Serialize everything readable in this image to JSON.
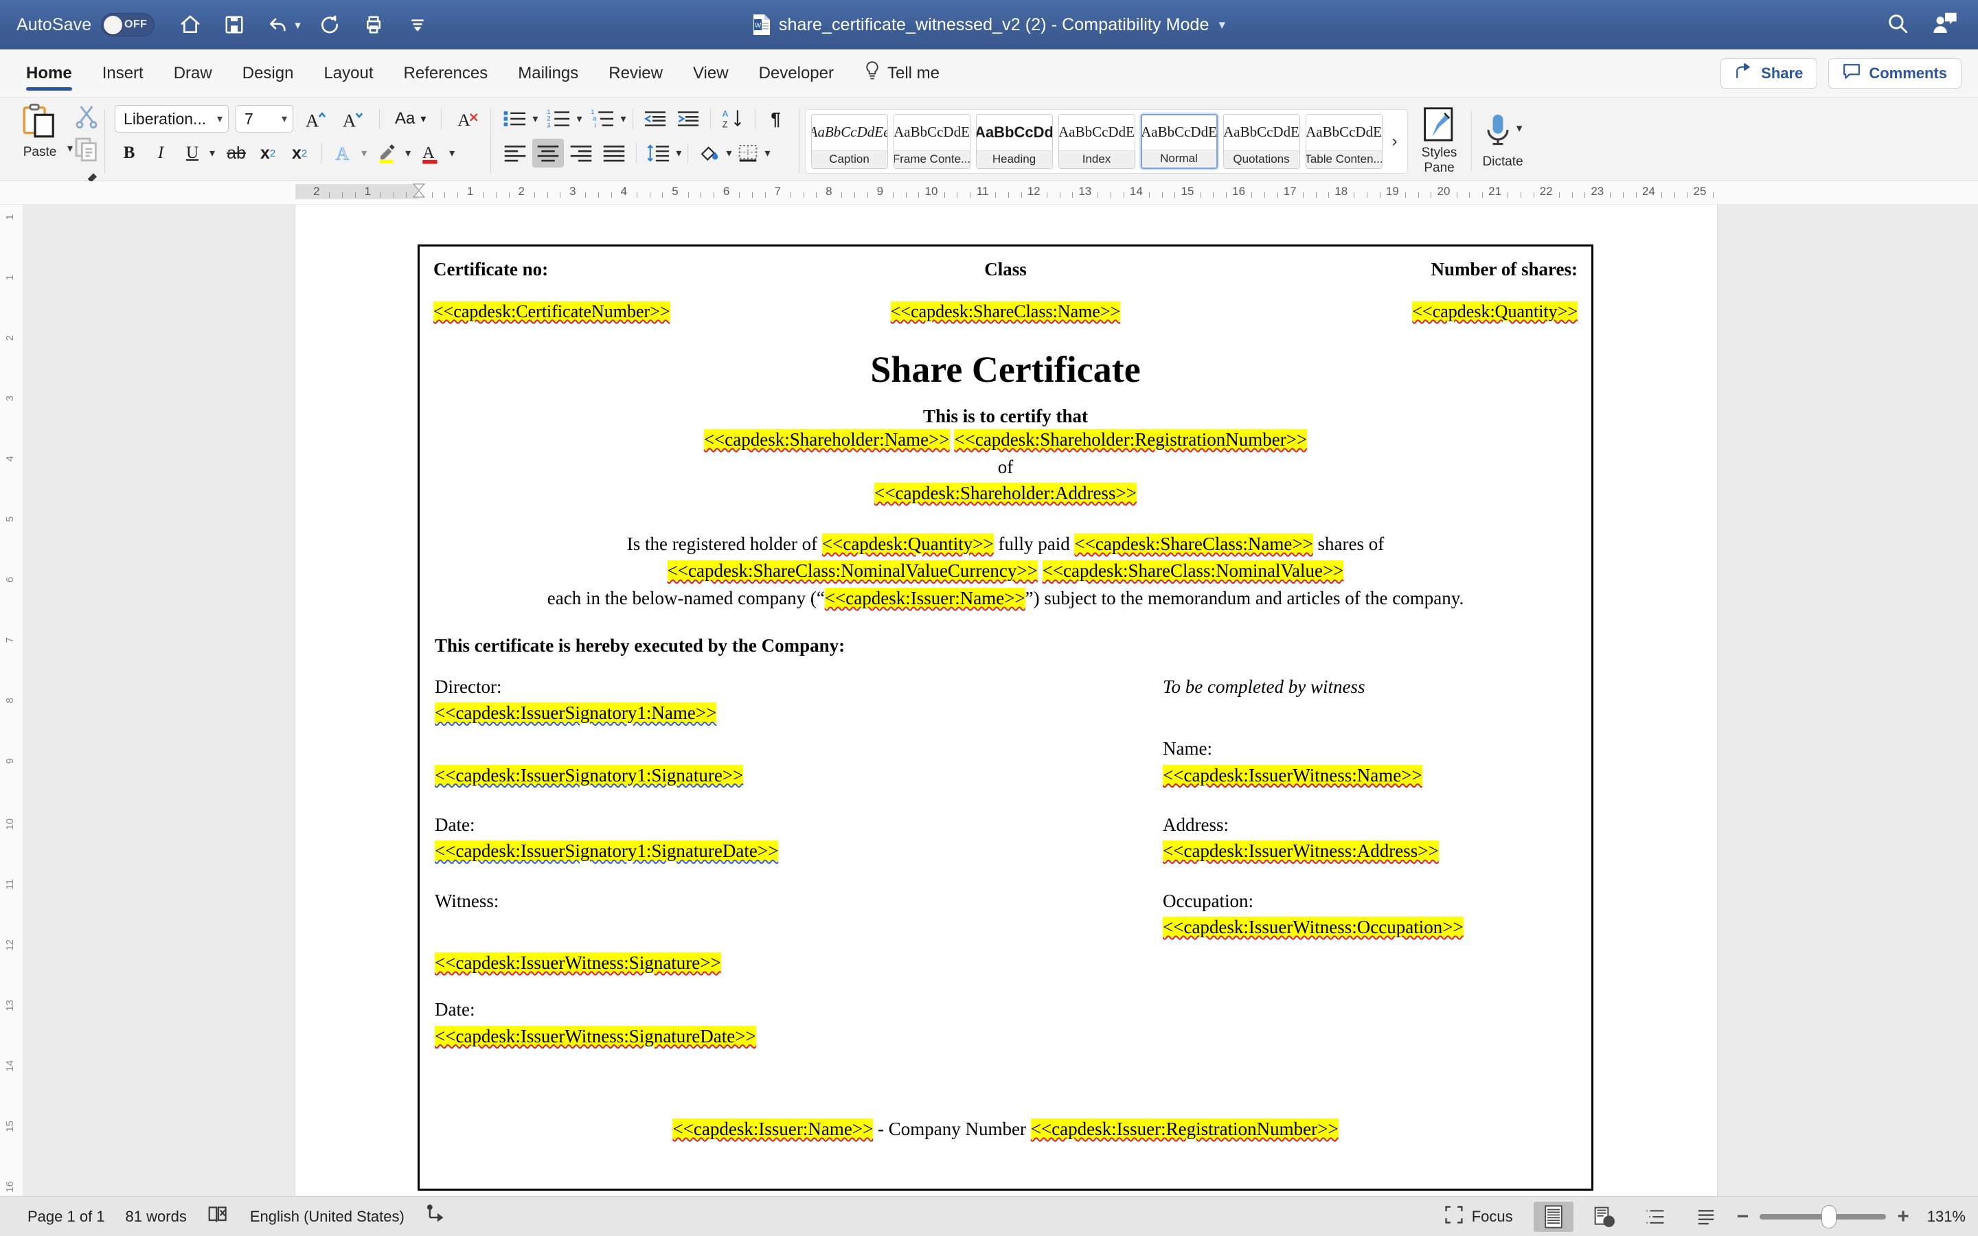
{
  "titlebar": {
    "autosave_label": "AutoSave",
    "autosave_state": "OFF",
    "doc_title": "share_certificate_witnessed_v2 (2)  -  Compatibility Mode",
    "quick_access": [
      "home-icon",
      "save-icon",
      "undo-icon",
      "redo-icon",
      "print-icon",
      "customize-qat-icon"
    ],
    "right_icons": [
      "search-icon",
      "account-comment-icon"
    ]
  },
  "ribbon_tabs": {
    "items": [
      {
        "label": "Home",
        "active": true
      },
      {
        "label": "Insert",
        "active": false
      },
      {
        "label": "Draw",
        "active": false
      },
      {
        "label": "Design",
        "active": false
      },
      {
        "label": "Layout",
        "active": false
      },
      {
        "label": "References",
        "active": false
      },
      {
        "label": "Mailings",
        "active": false
      },
      {
        "label": "Review",
        "active": false
      },
      {
        "label": "View",
        "active": false
      },
      {
        "label": "Developer",
        "active": false
      }
    ],
    "tell_me": "Tell me",
    "share": "Share",
    "comments": "Comments"
  },
  "ribbon": {
    "paste_label": "Paste",
    "font_name": "Liberation...",
    "font_size": "7",
    "grow_font": "A",
    "shrink_font": "A",
    "change_case": "Aa",
    "clear_formatting": "A",
    "bold": "B",
    "italic": "I",
    "underline": "U",
    "strikethrough": "ab",
    "subscript": "x",
    "subscript_sub": "2",
    "superscript": "x",
    "superscript_sup": "2",
    "text_effects": "A",
    "highlight": "A",
    "font_color": "A",
    "styles": [
      {
        "preview": "AaBbCcDdEe",
        "name": "Caption",
        "style": "italic",
        "selected": false
      },
      {
        "preview": "AaBbCcDdE",
        "name": "Frame Conte...",
        "style": "serif",
        "selected": false
      },
      {
        "preview": "AaBbCcDd",
        "name": "Heading",
        "style": "bold",
        "selected": false
      },
      {
        "preview": "AaBbCcDdE",
        "name": "Index",
        "style": "serif",
        "selected": false
      },
      {
        "preview": "AaBbCcDdE",
        "name": "Normal",
        "style": "serif",
        "selected": true
      },
      {
        "preview": "AaBbCcDdE",
        "name": "Quotations",
        "style": "serif",
        "selected": false
      },
      {
        "preview": "AaBbCcDdE",
        "name": "Table Conten...",
        "style": "serif",
        "selected": false
      }
    ],
    "styles_pane_line1": "Styles",
    "styles_pane_line2": "Pane",
    "dictate_label": "Dictate"
  },
  "ruler": {
    "numbers": [
      "2",
      "1",
      "1",
      "2",
      "3",
      "4",
      "5",
      "6",
      "7",
      "8",
      "9",
      "10",
      "11",
      "12",
      "13",
      "14",
      "15",
      "16",
      "17",
      "18",
      "19",
      "20",
      "21",
      "22",
      "23",
      "24",
      "25"
    ],
    "vertical_numbers": [
      "1",
      "1",
      "2",
      "3",
      "4",
      "5",
      "6",
      "7",
      "8",
      "9",
      "10",
      "11",
      "12",
      "13",
      "14",
      "15",
      "16"
    ]
  },
  "document": {
    "header": {
      "certificate_no_label": "Certificate no:",
      "class_label": "Class",
      "number_of_shares_label": "Number of shares:",
      "certificate_no_value": "<<capdesk:CertificateNumber>>",
      "class_value": "<<capdesk:ShareClass:Name>>",
      "number_of_shares_value": "<<capdesk:Quantity>>"
    },
    "title": "Share Certificate",
    "certify_line": "This is to certify that",
    "shareholder_name": "<<capdesk:Shareholder:Name>>",
    "shareholder_registration": "<<capdesk:Shareholder:RegistrationNumber>>",
    "of_word": "of",
    "shareholder_address": "<<capdesk:Shareholder:Address>>",
    "body": {
      "line1_pre": "Is the registered holder of ",
      "line1_quantity": "<<capdesk:Quantity>>",
      "line1_mid": " fully paid ",
      "line1_shareclass": "<<capdesk:ShareClass:Name>>",
      "line1_post": " shares of",
      "line2_currency": "<<capdesk:ShareClass:NominalValueCurrency>>",
      "line2_nominal": "<<capdesk:ShareClass:NominalValue>>",
      "line3_pre": "each in the below-named company (“",
      "line3_issuer": "<<capdesk:Issuer:Name>>",
      "line3_post": "”) subject to the memorandum and articles of the company."
    },
    "executed_line": "This certificate is hereby executed by the Company:",
    "left_column": {
      "director_label": "Director:",
      "director_name": "<<capdesk:IssuerSignatory1:Name>>",
      "director_signature": "<<capdesk:IssuerSignatory1:Signature>>",
      "date_label_1": "Date:",
      "director_signature_date": "<<capdesk:IssuerSignatory1:SignatureDate>>",
      "witness_label": "Witness:",
      "witness_signature": "<<capdesk:IssuerWitness:Signature>>",
      "date_label_2": "Date:",
      "witness_signature_date": "<<capdesk:IssuerWitness:SignatureDate>>"
    },
    "right_column": {
      "heading": "To be completed by witness",
      "name_label": "Name:",
      "witness_name": "<<capdesk:IssuerWitness:Name>>",
      "address_label": "Address:",
      "witness_address": "<<capdesk:IssuerWitness:Address>>",
      "occupation_label": "Occupation:",
      "witness_occupation": "<<capdesk:IssuerWitness:Occupation>>"
    },
    "footer": {
      "issuer_name": "<<capdesk:Issuer:Name>>",
      "separator": " - Company Number ",
      "issuer_registration": "<<capdesk:Issuer:RegistrationNumber>>"
    }
  },
  "statusbar": {
    "page_info": "Page 1 of 1",
    "word_count": "81 words",
    "language": "English (United States)",
    "focus_label": "Focus",
    "zoom_level": "131%",
    "zoom_out": "−",
    "zoom_in": "+"
  },
  "colors": {
    "titlebar": "#3e5e96",
    "accent": "#2b579a",
    "highlight": "#ffff00",
    "spell_error": "#e02020",
    "grammar_error": "#3a5fcd"
  }
}
